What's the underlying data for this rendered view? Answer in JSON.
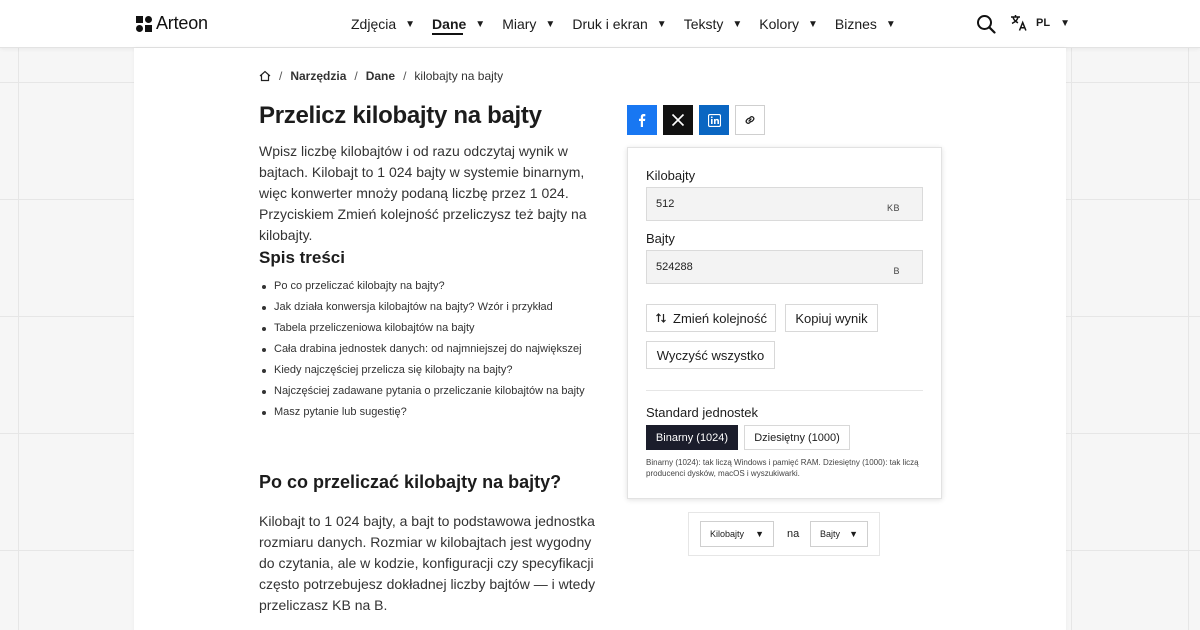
{
  "header": {
    "logo_text": "Arteon",
    "nav": [
      {
        "label": "Zdjęcia",
        "active": false
      },
      {
        "label": "Dane",
        "active": true
      },
      {
        "label": "Miary",
        "active": false
      },
      {
        "label": "Druk i ekran",
        "active": false
      },
      {
        "label": "Teksty",
        "active": false
      },
      {
        "label": "Kolory",
        "active": false
      },
      {
        "label": "Biznes",
        "active": false
      }
    ],
    "lang_code": "PL",
    "icons": {
      "search": "search-icon",
      "translate": "translate-icon",
      "caret": "caret-down-icon"
    }
  },
  "breadcrumb": {
    "items": [
      "Narzędzia",
      "Dane",
      "kilobajty na bajty"
    ],
    "separator": "/"
  },
  "page": {
    "title": "Przelicz kilobajty na bajty",
    "intro": "Wpisz liczbę kilobajtów i od razu odczytaj wynik w bajtach. Kilobajt to 1 024 bajty w systemie binarnym, więc konwerter mnoży podaną liczbę przez 1 024. Przyciskiem Zmień kolejność przeliczysz też bajty na kilobajty.",
    "toc_title": "Spis treści",
    "toc": [
      "Po co przeliczać kilobajty na bajty?",
      "Jak działa konwersja kilobajtów na bajty? Wzór i przykład",
      "Tabela przeliczeniowa kilobajtów na bajty",
      "Cała drabina jednostek danych: od najmniejszej do największej",
      "Kiedy najczęściej przelicza się kilobajty na bajty?",
      "Najczęściej zadawane pytania o przeliczanie kilobajtów na bajty",
      "Masz pytanie lub sugestię?"
    ],
    "section_title": "Po co przeliczać kilobajty na bajty?",
    "section_body": "Kilobajt to 1 024 bajty, a bajt to podstawowa jednostka rozmiaru danych. Rozmiar w kilobajtach jest wygodny do czytania, ale w kodzie, konfiguracji czy specyfikacji często potrzebujesz dokładnej liczby bajtów — i wtedy przeliczasz KB na B."
  },
  "share": {
    "colors": {
      "facebook": "#1877f2",
      "x": "#111111",
      "linkedin": "#0a66c2"
    }
  },
  "converter": {
    "from_label": "Kilobajty",
    "from_value": "512",
    "from_unit": "KB",
    "to_label": "Bajty",
    "to_value": "524288",
    "to_unit": "B",
    "swap_label": "Zmień kolejność",
    "copy_label": "Kopiuj wynik",
    "clear_label": "Wyczyść wszystko",
    "standard_label": "Standard jednostek",
    "standard_options": [
      "Binarny (1024)",
      "Dziesiętny (1000)"
    ],
    "standard_selected": "Binarny (1024)",
    "standard_note": "Binarny (1024): tak liczą Windows i pamięć RAM. Dziesiętny (1000): tak liczą producenci dysków, macOS i wyszukiwarki."
  },
  "unit_pair": {
    "from": "Kilobajty",
    "joiner": "na",
    "to": "Bajty"
  }
}
